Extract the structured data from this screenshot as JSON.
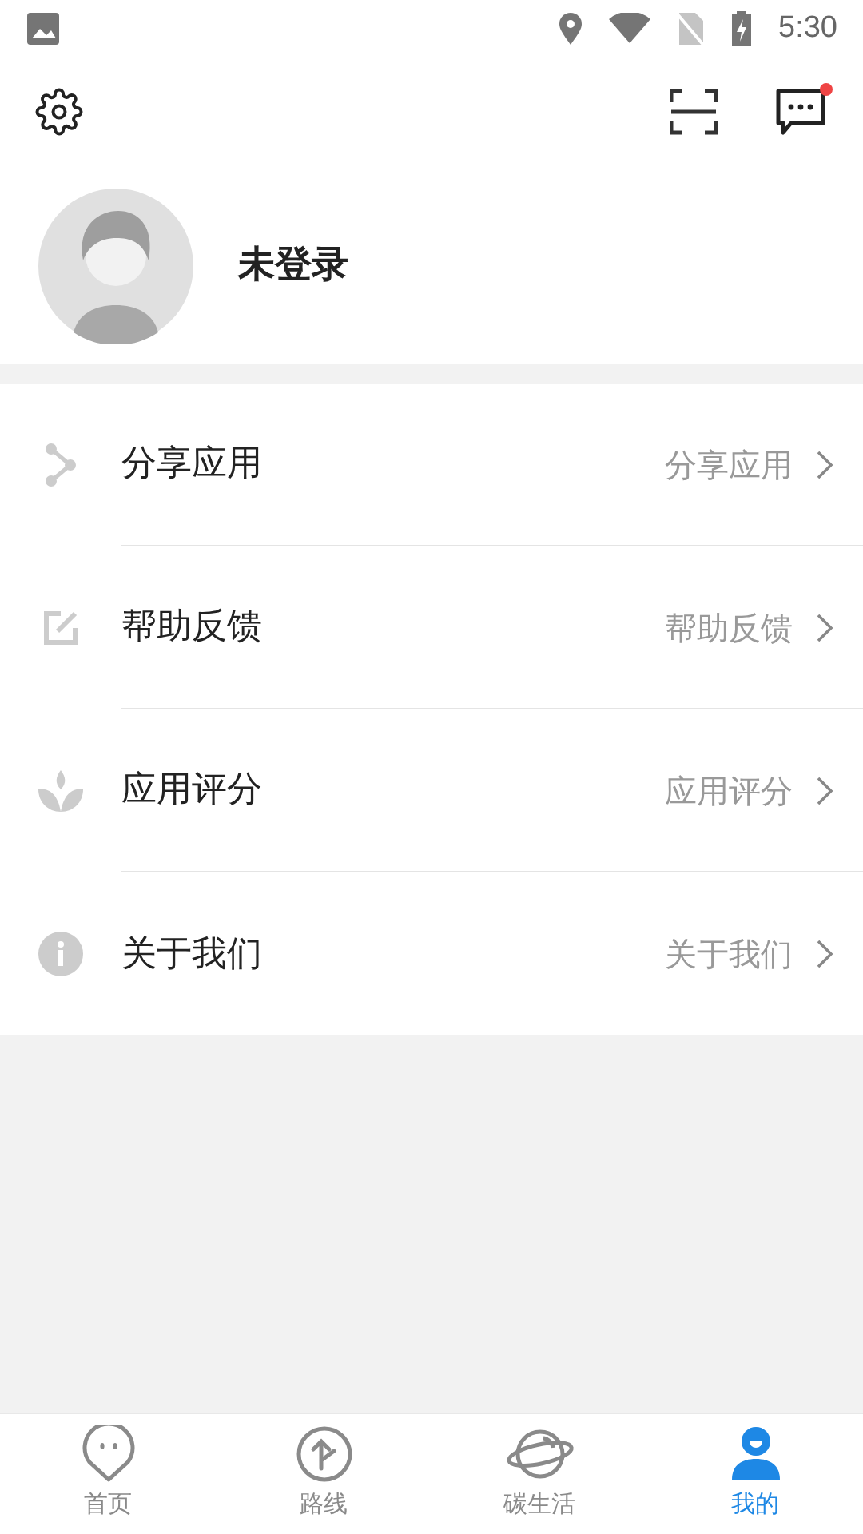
{
  "status_bar": {
    "time": "5:30"
  },
  "toolbar": {
    "message_unread": true
  },
  "profile": {
    "name": "未登录"
  },
  "menu": [
    {
      "kind": "share",
      "label": "分享应用",
      "value": "分享应用"
    },
    {
      "kind": "edit",
      "label": "帮助反馈",
      "value": "帮助反馈"
    },
    {
      "kind": "lotus",
      "label": "应用评分",
      "value": "应用评分"
    },
    {
      "kind": "info",
      "label": "关于我们",
      "value": "关于我们"
    }
  ],
  "tab_bar": [
    {
      "kind": "home",
      "label": "首页",
      "selected": false
    },
    {
      "kind": "route",
      "label": "路线",
      "selected": false
    },
    {
      "kind": "planet",
      "label": "碳生活",
      "selected": false
    },
    {
      "kind": "me",
      "label": "我的",
      "selected": true
    }
  ]
}
